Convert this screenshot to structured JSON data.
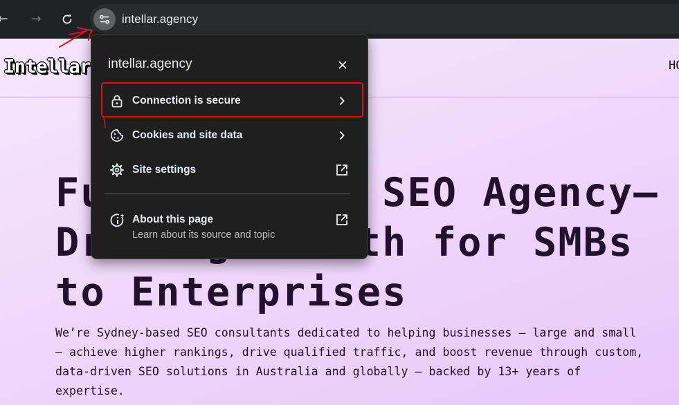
{
  "browser": {
    "url": "intellar.agency",
    "nav": {
      "back": "back-arrow-icon",
      "forward": "forward-arrow-icon",
      "reload": "reload-icon"
    },
    "site_info_icon": "tune-icon"
  },
  "site": {
    "logo_text": "Intellar",
    "nav_partial": "HO",
    "hero_title": "Full-Service SEO Agency—\nDriving Growth for SMBs\nto Enterprises",
    "hero_description": "We’re Sydney-based SEO consultants dedicated to helping businesses — large and small\n— achieve higher rankings, drive qualified traffic, and boost revenue through custom,\ndata-driven SEO solutions in Australia and globally — backed by 13+ years of\nexpertise."
  },
  "popup": {
    "title": "intellar.agency",
    "close_icon": "close-icon",
    "items": [
      {
        "label": "Connection is secure",
        "icon": "lock-icon",
        "trail_icon": "chevron-right-icon"
      },
      {
        "label": "Cookies and site data",
        "icon": "cookie-icon",
        "trail_icon": "chevron-right-icon"
      },
      {
        "label": "Site settings",
        "icon": "settings-icon",
        "trail_icon": "external-link-icon"
      }
    ],
    "about": {
      "label": "About this page",
      "sublabel": "Learn about its source and topic",
      "icon": "about-page-icon",
      "trail_icon": "external-link-icon"
    }
  },
  "colors": {
    "popup_bg": "#1f1f1f",
    "annotation": "#d8141b",
    "page_bg": "#f2dcfb",
    "hero_text": "#22102e"
  }
}
